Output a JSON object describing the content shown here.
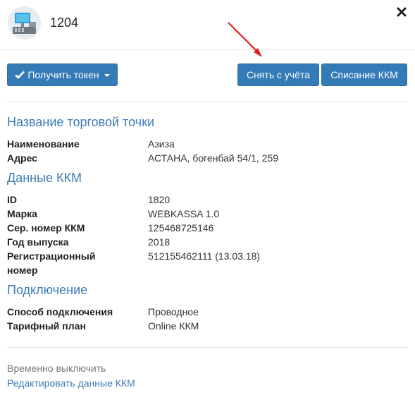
{
  "header": {
    "title": "1204"
  },
  "toolbar": {
    "get_token_label": "Получить токен",
    "deregister_label": "Снять с учёта",
    "writeoff_label": "Списание ККМ"
  },
  "sections": {
    "store": {
      "heading": "Название торговой точки",
      "rows": [
        {
          "label": "Наименование",
          "value": "Азиза"
        },
        {
          "label": "Адрес",
          "value": "АСТАНА, богенбай 54/1, 259"
        }
      ]
    },
    "kkm": {
      "heading": "Данные ККМ",
      "rows": [
        {
          "label": "ID",
          "value": "1820"
        },
        {
          "label": "Марка",
          "value": "WEBKASSA 1.0"
        },
        {
          "label": "Сер. номер ККМ",
          "value": "125468725146"
        },
        {
          "label": "Год выпуска",
          "value": "2018"
        },
        {
          "label": "Регистрационный номер",
          "value": "512155462111 (13.03.18)"
        }
      ]
    },
    "connection": {
      "heading": "Подключение",
      "rows": [
        {
          "label": "Способ подключения",
          "value": "Проводное"
        },
        {
          "label": "Тарифный план",
          "value": "Online ККМ"
        }
      ]
    }
  },
  "footer": {
    "disable_text": "Временно выключить",
    "edit_link": "Редактировать данные ККМ"
  },
  "colors": {
    "primary": "#337ab7",
    "heading": "#3c7bb5",
    "annotation_arrow": "#e02020"
  },
  "icons": {
    "avatar": "cash-register-icon",
    "close": "close-icon",
    "check": "check-icon",
    "caret": "caret-down-icon"
  }
}
